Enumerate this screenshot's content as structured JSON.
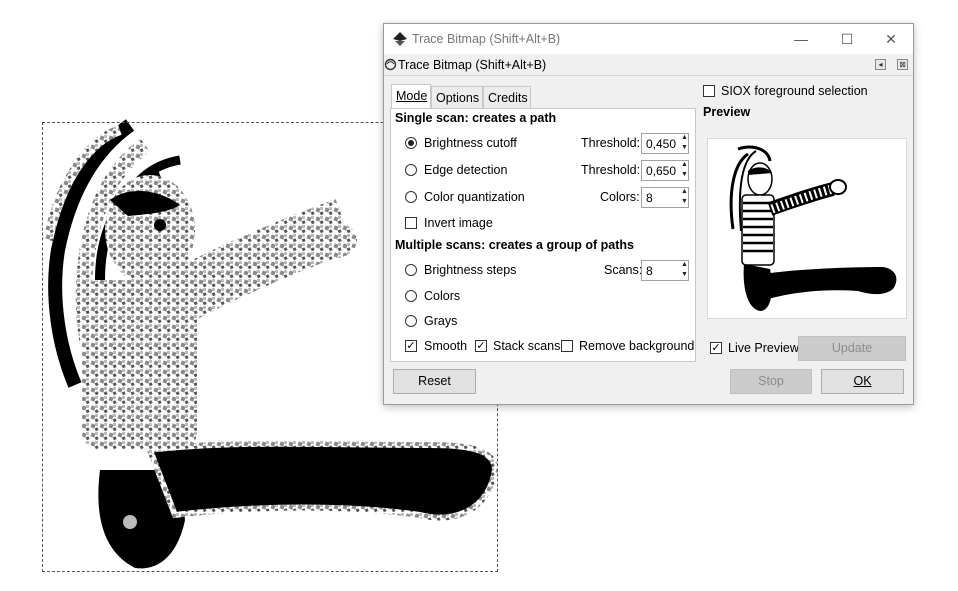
{
  "dialog": {
    "window_title": "Trace Bitmap (Shift+Alt+B)",
    "dock_title": "Trace Bitmap (Shift+Alt+B)",
    "minimize_glyph": "—",
    "maximize_glyph": "☐",
    "close_glyph": "✕",
    "dock_left_glyph": "◂",
    "dock_close_glyph": "⊠"
  },
  "tabs": [
    {
      "label": "Mode",
      "active": true
    },
    {
      "label": "Options",
      "active": false
    },
    {
      "label": "Credits",
      "active": false
    }
  ],
  "single_scan": {
    "heading": "Single scan: creates a path",
    "brightness_cutoff": {
      "label": "Brightness cutoff",
      "selected": true,
      "param_label": "Threshold:",
      "value": "0,450"
    },
    "edge_detection": {
      "label": "Edge detection",
      "selected": false,
      "param_label": "Threshold:",
      "value": "0,650"
    },
    "color_quantization": {
      "label": "Color quantization",
      "selected": false,
      "param_label": "Colors:",
      "value": "8"
    },
    "invert_image": {
      "label": "Invert image",
      "checked": false
    }
  },
  "multiple_scans": {
    "heading": "Multiple scans: creates a group of paths",
    "brightness_steps": {
      "label": "Brightness steps",
      "selected": false,
      "param_label": "Scans:",
      "value": "8"
    },
    "colors": {
      "label": "Colors",
      "selected": false
    },
    "grays": {
      "label": "Grays",
      "selected": false
    },
    "smooth": {
      "label": "Smooth",
      "checked": true
    },
    "stack_scans": {
      "label": "Stack scans",
      "checked": true
    },
    "remove_background": {
      "label": "Remove background",
      "checked": false
    }
  },
  "siox": {
    "label": "SIOX foreground selection",
    "checked": false
  },
  "preview": {
    "heading": "Preview",
    "live_preview": {
      "label": "Live Preview",
      "checked": true
    },
    "update_label": "Update"
  },
  "buttons": {
    "reset": "Reset",
    "stop": "Stop",
    "ok": "OK"
  },
  "glyphs": {
    "check": "✓",
    "spin_up": "▲",
    "spin_down": "▼"
  },
  "colors": {
    "dialog_bg": "#f0f0f0",
    "disabled_button": "#cccccc"
  },
  "icons": [
    "inkscape-icon",
    "trace-bitmap-icon",
    "minimize-icon",
    "maximize-icon",
    "close-icon"
  ]
}
